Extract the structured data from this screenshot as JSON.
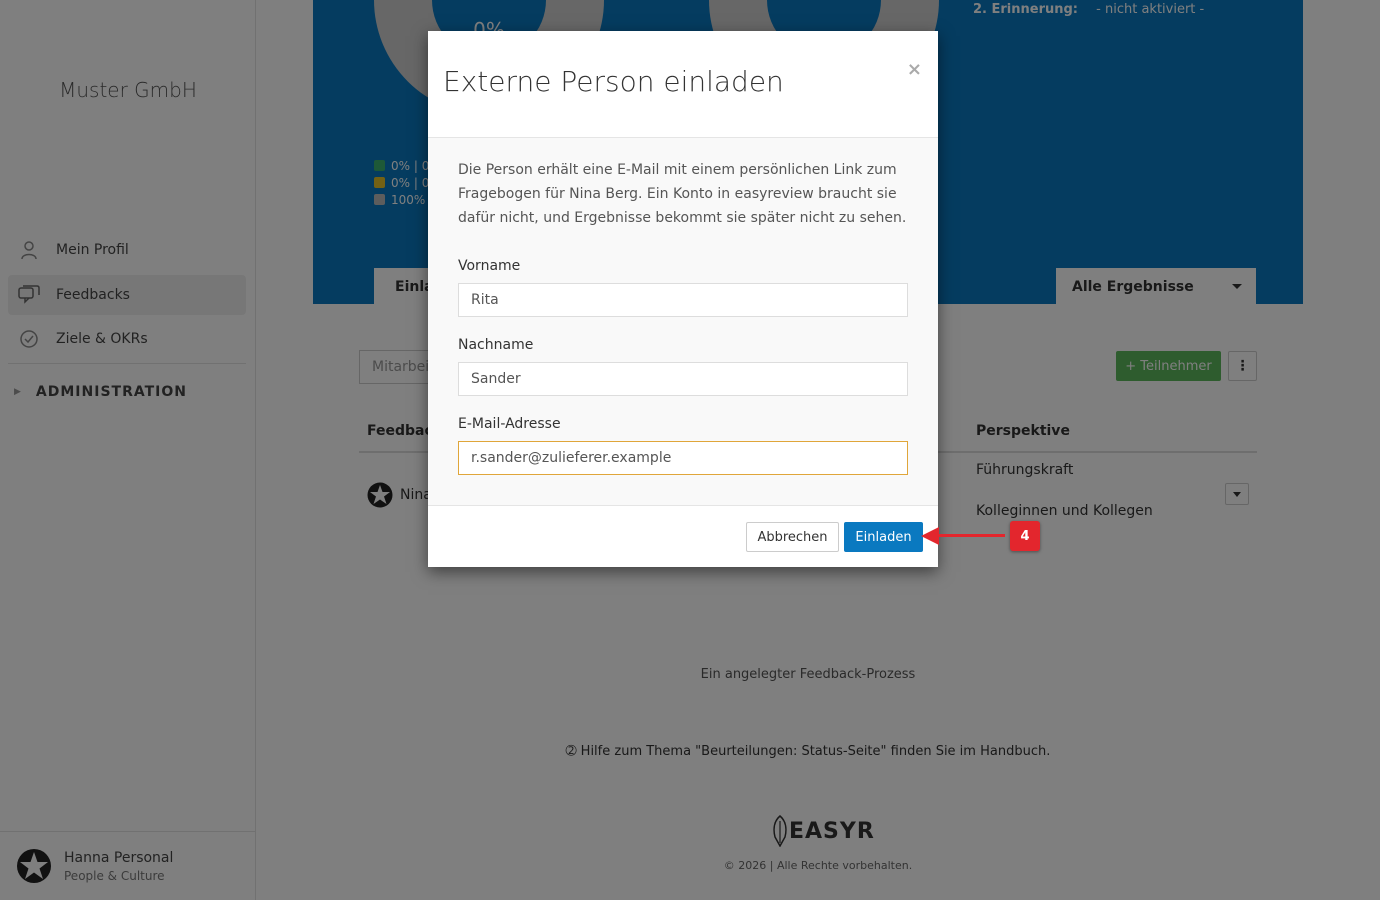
{
  "sidebar": {
    "company": "Muster GmbH",
    "items": [
      {
        "label": "Mein Profil",
        "icon": "user-icon"
      },
      {
        "label": "Feedbacks",
        "icon": "chat-icon"
      },
      {
        "label": "Ziele & OKRs",
        "icon": "check-circle-icon"
      }
    ],
    "admin_label": "ADMINISTRATION",
    "user": {
      "name": "Hanna Personal",
      "role": "People & Culture"
    }
  },
  "status_panel": {
    "donut_label": "0%",
    "legend": [
      {
        "text": "0% | 0",
        "color": "#3cb371"
      },
      {
        "text": "0% | 0",
        "color": "#e6c229"
      },
      {
        "text": "100% |",
        "color": "#bbbbbb"
      }
    ],
    "reminder_label": "2. Erinnerung:",
    "reminder_value": "- nicht aktiviert -",
    "tab_left": "Einlad",
    "filter_select": "Alle Ergebnisse"
  },
  "content": {
    "search_placeholder": "Mitarbei",
    "add_button": "+ Teilnehmer",
    "more_button": "⋮",
    "columns": {
      "feedback": "Feedback",
      "perspective": "Perspektive"
    },
    "row": {
      "name": "Nina",
      "perspectives": [
        "Führungskraft",
        "Kolleginnen und Kollegen"
      ]
    },
    "count_text": "Ein angelegter Feedback-Prozess",
    "help_text": "Hilfe zum Thema \"Beurteilungen: Status-Seite\" finden Sie im Handbuch."
  },
  "footer": {
    "logo_text": "EASYR",
    "copyright": "© 2026 | Alle Rechte vorbehalten."
  },
  "modal": {
    "title": "Externe Person einladen",
    "close": "×",
    "description": "Die Person erhält eine E-Mail mit einem persönlichen Link zum Fragebogen für Nina Berg. Ein Konto in easyreview braucht sie dafür nicht, und Ergebnisse bekommt sie später nicht zu sehen.",
    "fields": {
      "first_name": {
        "label": "Vorname",
        "value": "Rita"
      },
      "last_name": {
        "label": "Nachname",
        "value": "Sander"
      },
      "email": {
        "label": "E-Mail-Adresse",
        "value": "r.sander@zulieferer.example"
      }
    },
    "cancel": "Abbrechen",
    "submit": "Einladen"
  },
  "annotation": {
    "step": "4",
    "color": "#e3262d"
  },
  "colors": {
    "primary": "#0a79c0",
    "success": "#5cb85c",
    "focus_border": "#e0a63a"
  }
}
